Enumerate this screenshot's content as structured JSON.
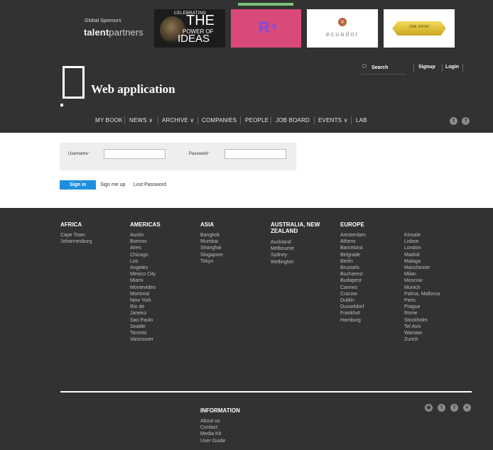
{
  "header": {
    "sponsor_label": "Global Sponsors",
    "sponsor_brand_bold": "talent",
    "sponsor_brand_thin": "partners",
    "ads": {
      "ideas": {
        "line1": "CELEBRATING",
        "line2": "THE",
        "line3": "POWER OF",
        "line4": "IDEAS"
      },
      "pink": {
        "mark": "R⁴"
      },
      "ecuador": {
        "logo": "v",
        "word": "ecuador"
      },
      "gold": {
        "label": "ONE SHOW"
      }
    },
    "site_title": "Web application",
    "search_label": "Search",
    "signup_label": "Signup",
    "login_label": "Login",
    "nav": [
      "MY BOOK",
      "NEWS ∨",
      "ARCHIVE ∨",
      "COMPANIES",
      "PEOPLE",
      "JOB BOARD",
      "EVENTS ∨",
      "LAB"
    ],
    "social": [
      "t",
      "f"
    ]
  },
  "login": {
    "username_label": "Username",
    "password_label": "Password",
    "required_mark": "*",
    "username_value": "",
    "password_value": "",
    "signin_label": "Sign in",
    "signup_link": "Sign me up",
    "lost_password_link": "Lost Password"
  },
  "footer": {
    "regions": [
      {
        "title": "AFRICA",
        "cities": [
          "Cape Town",
          "Johannesburg"
        ]
      },
      {
        "title": "AMERICAS",
        "cities": [
          "Austin",
          "Buenos",
          "Aires",
          "Chicago",
          "Los",
          "Angeles",
          "Mexico City",
          "Miami",
          "Montevideo",
          "Montreal",
          "New York",
          "Rio de",
          "Janeiro",
          "Sao Paulo",
          "Seattle",
          "Toronto",
          "Vancouver"
        ]
      },
      {
        "title": "ASIA",
        "cities": [
          "Bangkok",
          "Mumbai",
          "Shanghai",
          "Singapore",
          "Tokyo"
        ]
      },
      {
        "title": "AUSTRALIA, NEW ZEALAND",
        "cities": [
          "Auckland",
          "Melbourne",
          "Sydney",
          "Wellington"
        ]
      },
      {
        "title": "EUROPE",
        "cities": [
          "Amsterdam",
          "Athens",
          "Barcelona",
          "Belgrade",
          "Berlin",
          "Brussels",
          "Bucharest",
          "Budapest",
          "Cannes",
          "Cracow",
          "Dublin",
          "Dusseldorf",
          "Frankfurt",
          "Hamburg"
        ]
      },
      {
        "title": "",
        "cities": [
          "Kinsale",
          "Lisbon",
          "London",
          "Madrid",
          "Malaga",
          "Manchester",
          "Milan",
          "Moscow",
          "Munich",
          "Palma, Mallorca",
          "Paris",
          "Prague",
          "Rome",
          "Stockholm",
          "Tel Aviv",
          "Warsaw",
          "Zurich"
        ]
      }
    ],
    "info_title": "INFORMATION",
    "info_links": [
      "About us",
      "Contact",
      "Media Kit",
      "User Guide"
    ],
    "social": [
      "◉",
      "t",
      "f",
      "+"
    ]
  }
}
